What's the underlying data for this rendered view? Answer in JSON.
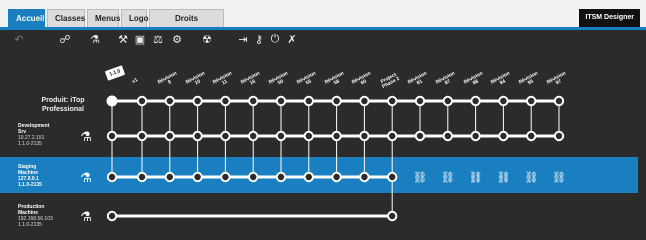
{
  "tabs": [
    {
      "label": "Accueil",
      "active": true
    },
    {
      "label": "Classes",
      "active": false
    },
    {
      "label": "Menus",
      "active": false
    },
    {
      "label": "Logo",
      "active": false
    },
    {
      "label": "Droits utilisateurs",
      "active": false
    }
  ],
  "app_title": "ITSM Designer",
  "toolbar": [
    "undo-icon",
    "workflow-icon",
    "flask-icon",
    "build-icon",
    "save-icon",
    "balance-icon",
    "settings-icon",
    "radiation-icon",
    "export-icon",
    "key-icon",
    "power-icon",
    "tools-icon"
  ],
  "product_label": {
    "line1": "Produit: iTop",
    "line2": "Professional"
  },
  "version_tag": "1.1.0",
  "columns": [
    "v1",
    "Révision 8",
    "Révision 10",
    "Révision 11",
    "Révision 16",
    "Révision 50",
    "Révision 55",
    "Révision 58",
    "Révision 60",
    "Project Phase 2",
    "Révision 81",
    "Révision 87",
    "Révision 88",
    "Révision 94",
    "Révision 95",
    "Révision 97"
  ],
  "rows": [
    {
      "name": "Development",
      "name2": "Srv",
      "ip": "10.27.2.151",
      "version": "1.1.0-2135"
    },
    {
      "name": "Staging",
      "name2": "Machine",
      "ip": "127.0.0.1",
      "version": "1.1.0-2135"
    },
    {
      "name": "Production",
      "name2": "Machine",
      "ip": "192.168.56.103",
      "version": "1.1.0-2135"
    }
  ],
  "colors": {
    "accent": "#1a7fc1",
    "bg": "#2b2b2b",
    "line": "#ffffff"
  }
}
